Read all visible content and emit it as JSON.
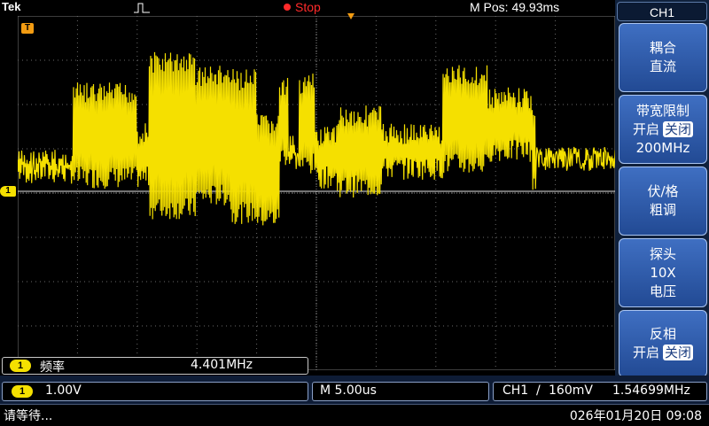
{
  "top": {
    "brand": "Tek",
    "run_state": "Stop",
    "m_pos": "M Pos: 49.93ms",
    "trigger_marker": "T"
  },
  "channel_marker": "1",
  "menu": {
    "title": "CH1",
    "buttons": [
      {
        "line1": "耦合",
        "line2": "直流"
      },
      {
        "line1": "带宽限制",
        "line2": "开启",
        "inv": "关闭",
        "line3": "200MHz"
      },
      {
        "line1": "伏/格",
        "line2": "粗调"
      },
      {
        "line1": "探头",
        "line2": "10X",
        "line3": "电压"
      },
      {
        "line1": "反相",
        "line2": "开启",
        "inv": "关闭"
      }
    ]
  },
  "measurement": {
    "channel": "1",
    "label": "频率",
    "value": "4.401MHz"
  },
  "vertical": {
    "channel": "1",
    "scale": "1.00V"
  },
  "timebase": "M 5.00us",
  "trigger": {
    "source": "CH1",
    "slope": "/",
    "level": "160mV",
    "freq": "1.54699MHz"
  },
  "status": {
    "message": "请等待...",
    "datetime": "026年01月20日 09:08"
  },
  "colors": {
    "trace": "#f5e000",
    "stop": "#ff2a2a",
    "menu_button": "#2f5cac",
    "background": "#000000"
  }
}
